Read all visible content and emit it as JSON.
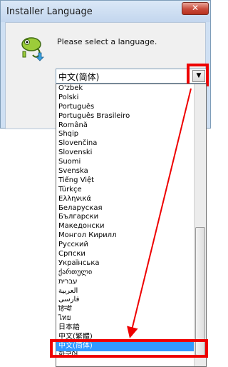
{
  "window": {
    "title": "Installer Language",
    "close_label": "✕"
  },
  "prompt": "Please select a language.",
  "combo": {
    "selected": "中文(简体)",
    "dropdown_arrow": "▼"
  },
  "languages": [
    "O'zbek",
    "Polski",
    "Português",
    "Português Brasileiro",
    "Română",
    "Shqip",
    "Slovenčina",
    "Slovenski",
    "Suomi",
    "Svenska",
    "Tiếng Việt",
    "Türkçe",
    "Ελληνικά",
    "Беларуская",
    "Български",
    "Македонски",
    "Монгол Кирилл",
    "Русский",
    "Српски",
    "Українська",
    "ქართული",
    "עברית",
    "العربية",
    "فارسی",
    "हिन्दी",
    "ไทย",
    "日本語",
    "中文(繁體)",
    "中文(简体)",
    "한국어"
  ],
  "selected_language_index": 28,
  "accent_colors": {
    "highlight_box": "#ee0000",
    "selection": "#3399ff"
  },
  "icons": {
    "app": "nsis-chameleon-icon",
    "close": "close-icon",
    "dropdown": "chevron-down-icon"
  }
}
